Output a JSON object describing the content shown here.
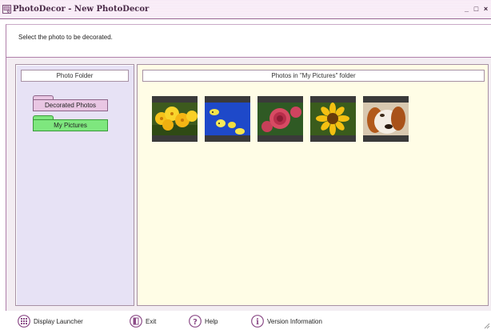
{
  "window": {
    "title": "PhotoDecor - New PhotoDecor",
    "controls": {
      "minimize": "_",
      "maximize": "□",
      "close": "×"
    }
  },
  "instruction": "Select the photo to be decorated.",
  "left_panel": {
    "header": "Photo Folder",
    "folders": [
      {
        "label": "Decorated Photos",
        "color": "#e9c6e3",
        "selected": false
      },
      {
        "label": "My Pictures",
        "color": "#7ee77e",
        "selected": true
      }
    ]
  },
  "right_panel": {
    "header": "Photos in \"My Pictures\" folder",
    "photos": [
      {
        "subject": "yellow-flowers"
      },
      {
        "subject": "blue-yellow-fish"
      },
      {
        "subject": "red-rose"
      },
      {
        "subject": "sunflower"
      },
      {
        "subject": "dog"
      }
    ]
  },
  "toolbar": {
    "display_launcher": "Display Launcher",
    "exit": "Exit",
    "help": "Help",
    "version_information": "Version Information"
  },
  "colors": {
    "accent": "#8c4c88",
    "left_panel_bg": "#e7e2f5",
    "right_panel_bg": "#fffde6"
  }
}
